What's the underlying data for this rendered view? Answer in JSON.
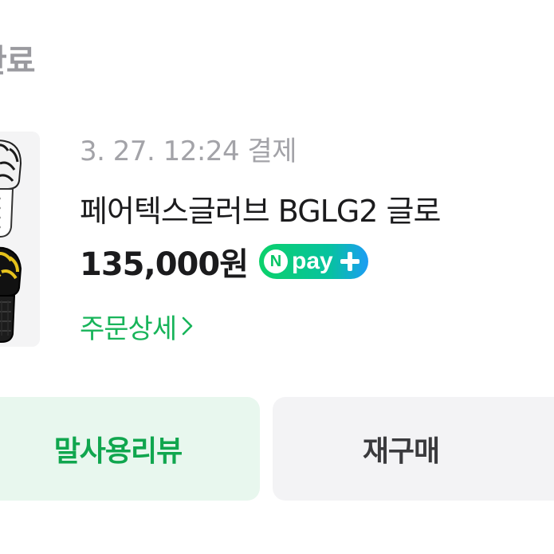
{
  "status": {
    "title": "완료"
  },
  "order": {
    "date": "3. 27. 12:24 결제",
    "product_name": "페어텍스글러브 BGLG2 글로",
    "price": "135,000원",
    "payment_badge": {
      "n_letter": "N",
      "text": "pay",
      "icon": "plus-icon"
    },
    "detail_link": "주문상세",
    "detail_icon": "chevron-right-icon"
  },
  "actions": {
    "review_label": "말사용리뷰",
    "rebuy_label": "재구매"
  },
  "colors": {
    "accent_green": "#18b45a",
    "review_bg": "#e8f7ee",
    "rebuy_bg": "#f3f3f5",
    "muted_text": "#a3a3a8"
  }
}
